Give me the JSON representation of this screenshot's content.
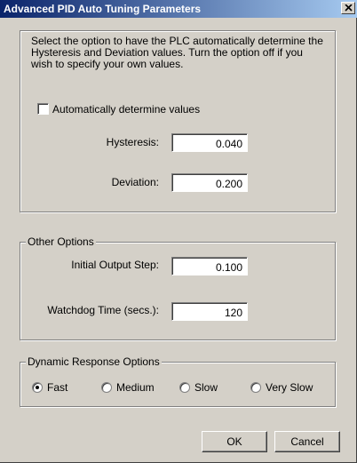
{
  "window": {
    "title": "Advanced PID Auto Tuning Parameters"
  },
  "auto_section": {
    "description": "Select the option to have the PLC automatically determine the Hysteresis and Deviation values.  Turn the option off if you wish to specify your own values.",
    "checkbox_label": "Automatically determine values",
    "checkbox_checked": false,
    "hysteresis_label": "Hysteresis:",
    "hysteresis_value": "0.040",
    "deviation_label": "Deviation:",
    "deviation_value": "0.200"
  },
  "other_options": {
    "title": "Other Options",
    "initial_output_step_label": "Initial Output Step:",
    "initial_output_step_value": "0.100",
    "watchdog_label": "Watchdog Time (secs.):",
    "watchdog_value": "120"
  },
  "dynamic_response": {
    "title": "Dynamic Response Options",
    "options": [
      "Fast",
      "Medium",
      "Slow",
      "Very Slow"
    ],
    "selected": "Fast"
  },
  "buttons": {
    "ok": "OK",
    "cancel": "Cancel"
  }
}
